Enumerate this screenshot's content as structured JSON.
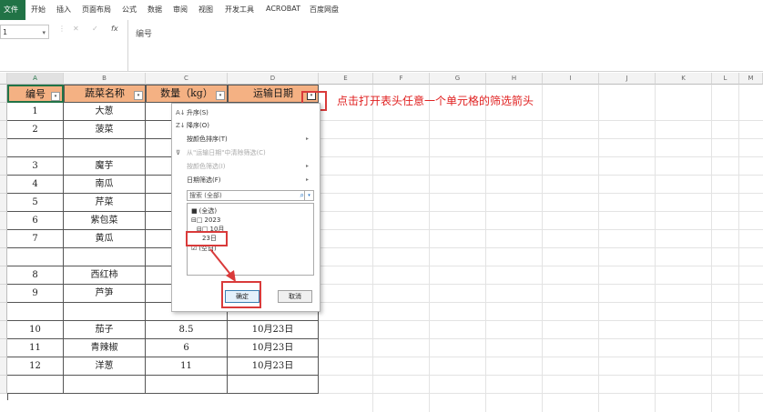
{
  "ribbon": {
    "tabs": [
      "文件",
      "开始",
      "插入",
      "页面布局",
      "公式",
      "数据",
      "审阅",
      "视图",
      "开发工具",
      "ACROBAT",
      "百度网盘"
    ]
  },
  "formula_bar": {
    "name_box": "1",
    "formula": "编号",
    "cancel_glyph": "✕",
    "confirm_glyph": "✓",
    "fx_glyph": "fx"
  },
  "columns": [
    "A",
    "B",
    "C",
    "D",
    "E",
    "F",
    "G",
    "H",
    "I",
    "J",
    "K",
    "L",
    "M"
  ],
  "header_row": [
    "编号",
    "蔬菜名称",
    "数量（kg）",
    "运输日期"
  ],
  "rows": [
    [
      "1",
      "大葱",
      "",
      ""
    ],
    [
      "2",
      "菠菜",
      "",
      ""
    ],
    [
      "",
      "",
      "",
      ""
    ],
    [
      "3",
      "魔芋",
      "",
      ""
    ],
    [
      "4",
      "南瓜",
      "",
      ""
    ],
    [
      "5",
      "芹菜",
      "",
      ""
    ],
    [
      "6",
      "紫包菜",
      "",
      ""
    ],
    [
      "7",
      "黄瓜",
      "",
      ""
    ],
    [
      "",
      "",
      "",
      ""
    ],
    [
      "8",
      "西红柿",
      "",
      ""
    ],
    [
      "9",
      "芦笋",
      "",
      ""
    ],
    [
      "",
      "",
      "",
      ""
    ],
    [
      "10",
      "茄子",
      "8.5",
      "10月23日"
    ],
    [
      "11",
      "青辣椒",
      "6",
      "10月23日"
    ],
    [
      "12",
      "洋葱",
      "11",
      "10月23日"
    ],
    [
      "",
      "",
      "",
      ""
    ]
  ],
  "annotation": "点击打开表头任意一个单元格的筛选箭头",
  "filter_menu": {
    "items": [
      {
        "icon": "A↓",
        "label": "升序(S)",
        "disabled": false,
        "arrow": false
      },
      {
        "icon": "Z↓",
        "label": "降序(O)",
        "disabled": false,
        "arrow": false
      },
      {
        "icon": "",
        "label": "按颜色排序(T)",
        "disabled": false,
        "arrow": true
      },
      {
        "icon": "⊽",
        "label": "从\"运输日期\"中清除筛选(C)",
        "disabled": true,
        "arrow": false
      },
      {
        "icon": "",
        "label": "按颜色筛选(I)",
        "disabled": true,
        "arrow": true
      },
      {
        "icon": "",
        "label": "日期筛选(F)",
        "disabled": false,
        "arrow": true
      }
    ],
    "search_placeholder": "搜索 (全部)",
    "tree": [
      {
        "indent": 0,
        "prefix": "",
        "checkbox": "■",
        "label": "(全选)"
      },
      {
        "indent": 0,
        "prefix": "⊟",
        "checkbox": "□",
        "label": "2023"
      },
      {
        "indent": 1,
        "prefix": "⊟",
        "checkbox": "□",
        "label": "10月"
      },
      {
        "indent": 2,
        "prefix": "",
        "checkbox": "",
        "label": "23日"
      },
      {
        "indent": 0,
        "prefix": "",
        "checkbox": "☑",
        "label": "(空白)"
      }
    ],
    "ok_label": "确定",
    "cancel_label": "取消"
  },
  "colors": {
    "header_fill": "#f4b183",
    "annotation": "#e02020",
    "excel_green": "#217346"
  }
}
